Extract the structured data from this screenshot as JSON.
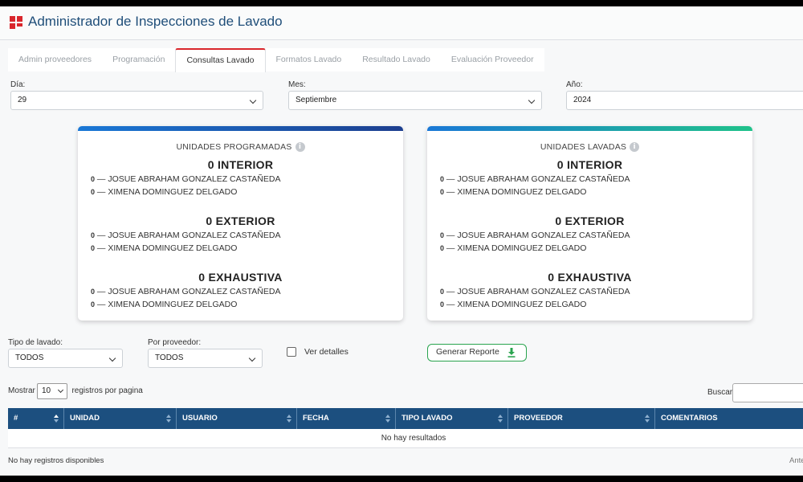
{
  "app": {
    "title": "Administrador de Inspecciones de Lavado"
  },
  "tabs": [
    {
      "label": "Admin proveedores",
      "active": false
    },
    {
      "label": "Programación",
      "active": false
    },
    {
      "label": "Consultas Lavado",
      "active": true
    },
    {
      "label": "Formatos Lavado",
      "active": false
    },
    {
      "label": "Resultado Lavado",
      "active": false
    },
    {
      "label": "Evaluación Proveedor",
      "active": false
    }
  ],
  "date_filters": {
    "day": {
      "label": "Día:",
      "value": "29"
    },
    "month": {
      "label": "Mes:",
      "value": "Septiembre"
    },
    "year": {
      "label": "Año:",
      "value": "2024"
    }
  },
  "cards": {
    "programadas": {
      "title": "UNIDADES PROGRAMADAS",
      "bar_color": "#1d5fa8",
      "groups": [
        {
          "heading": "0 INTERIOR",
          "lines": [
            {
              "count": "0",
              "text": " — JOSUE ABRAHAM GONZALEZ CASTAÑEDA"
            },
            {
              "count": "0",
              "text": " — XIMENA DOMINGUEZ DELGADO"
            }
          ]
        },
        {
          "heading": "0 EXTERIOR",
          "lines": [
            {
              "count": "0",
              "text": " — JOSUE ABRAHAM GONZALEZ CASTAÑEDA"
            },
            {
              "count": "0",
              "text": " — XIMENA DOMINGUEZ DELGADO"
            }
          ]
        },
        {
          "heading": "0 EXHAUSTIVA",
          "lines": [
            {
              "count": "0",
              "text": " — JOSUE ABRAHAM GONZALEZ CASTAÑEDA"
            },
            {
              "count": "0",
              "text": " — XIMENA DOMINGUEZ DELGADO"
            }
          ]
        }
      ]
    },
    "lavadas": {
      "title": "UNIDADES LAVADAS",
      "bar_color": "#1fb58a",
      "groups": [
        {
          "heading": "0 INTERIOR",
          "lines": [
            {
              "count": "0",
              "text": " — JOSUE ABRAHAM GONZALEZ CASTAÑEDA"
            },
            {
              "count": "0",
              "text": " — XIMENA DOMINGUEZ DELGADO"
            }
          ]
        },
        {
          "heading": "0 EXTERIOR",
          "lines": [
            {
              "count": "0",
              "text": " — JOSUE ABRAHAM GONZALEZ CASTAÑEDA"
            },
            {
              "count": "0",
              "text": " — XIMENA DOMINGUEZ DELGADO"
            }
          ]
        },
        {
          "heading": "0 EXHAUSTIVA",
          "lines": [
            {
              "count": "0",
              "text": " — JOSUE ABRAHAM GONZALEZ CASTAÑEDA"
            },
            {
              "count": "0",
              "text": " — XIMENA DOMINGUEZ DELGADO"
            }
          ]
        }
      ]
    }
  },
  "filters": {
    "tipo_lavado": {
      "label": "Tipo de lavado:",
      "value": "TODOS"
    },
    "proveedor": {
      "label": "Por proveedor:",
      "value": "TODOS"
    },
    "ver_detalles": {
      "label": "Ver detalles",
      "checked": false
    },
    "report_button": {
      "label": "Generar Reporte",
      "icon": "download-icon",
      "color": "#2aa44f"
    }
  },
  "table": {
    "length": {
      "prefix": "Mostrar",
      "value": "10",
      "suffix": "registros por pagina"
    },
    "search_label": "Buscar",
    "columns": [
      "#",
      "UNIDAD",
      "USUARIO",
      "FECHA",
      "TIPO LAVADO",
      "PROVEEDOR",
      "COMENTARIOS"
    ],
    "empty_text": "No hay resultados",
    "info": "No hay registros disponibles",
    "pager_prev": "Ante"
  },
  "colors": {
    "accent": "#d9262c",
    "header": "#1c4f7f"
  }
}
